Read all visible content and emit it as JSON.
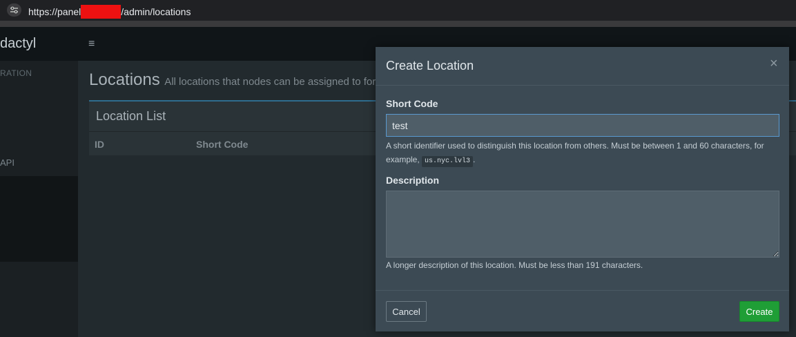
{
  "browser": {
    "url_prefix": "https://panel",
    "url_suffix": "/admin/locations",
    "site_info_icon": "tune-icon"
  },
  "header": {
    "logo_text": "dactyl",
    "menu_icon": "≡"
  },
  "sidebar": {
    "section_heading": "RATION",
    "item_api": "API"
  },
  "main": {
    "title": "Locations",
    "subtitle": "All locations that nodes can be assigned to for",
    "box_title": "Location List",
    "columns": [
      "ID",
      "Short Code"
    ]
  },
  "modal": {
    "title": "Create Location",
    "close_symbol": "×",
    "short_code_label": "Short Code",
    "short_code_value": "test",
    "short_code_help_before": "A short identifier used to distinguish this location from others. Must be between 1 and 60 characters, for example, ",
    "short_code_example": "us.nyc.lvl3",
    "short_code_help_after": ".",
    "description_label": "Description",
    "description_value": "",
    "description_help": "A longer description of this location. Must be less than 191 characters.",
    "cancel_label": "Cancel",
    "create_label": "Create"
  },
  "colors": {
    "accent_blue": "#2f6d8f",
    "create_green": "#1f9e36",
    "redaction_red": "#ee1111"
  }
}
